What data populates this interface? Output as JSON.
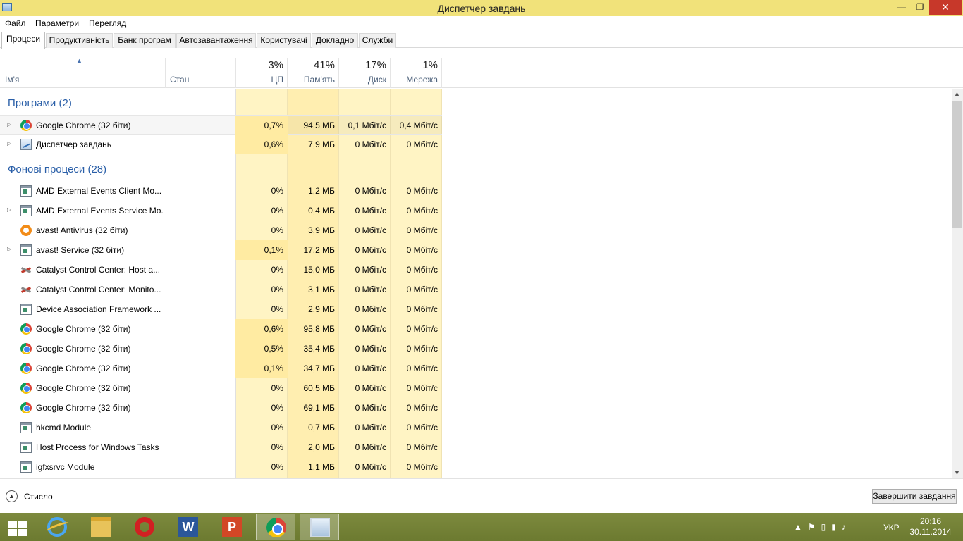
{
  "window": {
    "title": "Диспетчер завдань",
    "minimize": "—",
    "maximize": "❐",
    "close": "✕"
  },
  "menu": [
    "Файл",
    "Параметри",
    "Перегляд"
  ],
  "tabs": [
    "Процеси",
    "Продуктивність",
    "Банк програм",
    "Автозавантаження",
    "Користувачі",
    "Докладно",
    "Служби"
  ],
  "columns": {
    "name": "Ім'я",
    "status": "Стан",
    "cpu": {
      "label": "ЦП",
      "total": "3%"
    },
    "memory": {
      "label": "Пам'ять",
      "total": "41%"
    },
    "disk": {
      "label": "Диск",
      "total": "17%"
    },
    "network": {
      "label": "Мережа",
      "total": "1%"
    }
  },
  "groups": {
    "apps": "Програми (2)",
    "background": "Фонові процеси (28)"
  },
  "apps": [
    {
      "name": "Google Chrome (32 біти)",
      "icon": "chrome-icon",
      "expandable": true,
      "cpu": "0,7%",
      "memory": "94,5 МБ",
      "disk": "0,1 Мбіт/с",
      "network": "0,4 Мбіт/с"
    },
    {
      "name": "Диспетчер завдань",
      "icon": "task-manager-icon",
      "expandable": true,
      "cpu": "0,6%",
      "memory": "7,9 МБ",
      "disk": "0 Мбіт/с",
      "network": "0 Мбіт/с"
    }
  ],
  "background": [
    {
      "name": "AMD External Events Client Mo...",
      "icon": "app-window-icon",
      "expandable": false,
      "cpu": "0%",
      "memory": "1,2 МБ",
      "disk": "0 Мбіт/с",
      "network": "0 Мбіт/с"
    },
    {
      "name": "AMD External Events Service Mo...",
      "icon": "app-window-icon",
      "expandable": true,
      "cpu": "0%",
      "memory": "0,4 МБ",
      "disk": "0 Мбіт/с",
      "network": "0 Мбіт/с"
    },
    {
      "name": "avast! Antivirus (32 біти)",
      "icon": "avast-icon",
      "expandable": false,
      "cpu": "0%",
      "memory": "3,9 МБ",
      "disk": "0 Мбіт/с",
      "network": "0 Мбіт/с"
    },
    {
      "name": "avast! Service (32 біти)",
      "icon": "app-window-icon",
      "expandable": true,
      "cpu": "0,1%",
      "memory": "17,2 МБ",
      "disk": "0 Мбіт/с",
      "network": "0 Мбіт/с"
    },
    {
      "name": "Catalyst Control Center: Host a...",
      "icon": "amd-catalyst-icon",
      "expandable": false,
      "cpu": "0%",
      "memory": "15,0 МБ",
      "disk": "0 Мбіт/с",
      "network": "0 Мбіт/с"
    },
    {
      "name": "Catalyst Control Center: Monito...",
      "icon": "amd-catalyst-icon",
      "expandable": false,
      "cpu": "0%",
      "memory": "3,1 МБ",
      "disk": "0 Мбіт/с",
      "network": "0 Мбіт/с"
    },
    {
      "name": "Device Association Framework ...",
      "icon": "app-window-icon",
      "expandable": false,
      "cpu": "0%",
      "memory": "2,9 МБ",
      "disk": "0 Мбіт/с",
      "network": "0 Мбіт/с"
    },
    {
      "name": "Google Chrome (32 біти)",
      "icon": "chrome-icon",
      "expandable": false,
      "cpu": "0,6%",
      "memory": "95,8 МБ",
      "disk": "0 Мбіт/с",
      "network": "0 Мбіт/с"
    },
    {
      "name": "Google Chrome (32 біти)",
      "icon": "chrome-icon",
      "expandable": false,
      "cpu": "0,5%",
      "memory": "35,4 МБ",
      "disk": "0 Мбіт/с",
      "network": "0 Мбіт/с"
    },
    {
      "name": "Google Chrome (32 біти)",
      "icon": "chrome-icon",
      "expandable": false,
      "cpu": "0,1%",
      "memory": "34,7 МБ",
      "disk": "0 Мбіт/с",
      "network": "0 Мбіт/с"
    },
    {
      "name": "Google Chrome (32 біти)",
      "icon": "chrome-icon",
      "expandable": false,
      "cpu": "0%",
      "memory": "60,5 МБ",
      "disk": "0 Мбіт/с",
      "network": "0 Мбіт/с"
    },
    {
      "name": "Google Chrome (32 біти)",
      "icon": "chrome-icon",
      "expandable": false,
      "cpu": "0%",
      "memory": "69,1 МБ",
      "disk": "0 Мбіт/с",
      "network": "0 Мбіт/с"
    },
    {
      "name": "hkcmd Module",
      "icon": "app-window-icon",
      "expandable": false,
      "cpu": "0%",
      "memory": "0,7 МБ",
      "disk": "0 Мбіт/с",
      "network": "0 Мбіт/с"
    },
    {
      "name": "Host Process for Windows Tasks",
      "icon": "app-window-icon",
      "expandable": false,
      "cpu": "0%",
      "memory": "2,0 МБ",
      "disk": "0 Мбіт/с",
      "network": "0 Мбіт/с"
    },
    {
      "name": "igfxsrvc Module",
      "icon": "app-window-icon",
      "expandable": false,
      "cpu": "0%",
      "memory": "1,1 МБ",
      "disk": "0 Мбіт/с",
      "network": "0 Мбіт/с"
    }
  ],
  "footer": {
    "less_details": "Стисло",
    "end_task": "Завершити завдання"
  },
  "taskbar": {
    "items": [
      "start-icon",
      "internet-explorer-icon",
      "file-explorer-icon",
      "opera-icon",
      "word-icon",
      "powerpoint-icon",
      "chrome-icon",
      "task-manager-icon"
    ],
    "language": "УКР",
    "time": "20:16",
    "date": "30.11.2014"
  },
  "colors": {
    "titlebar": "#f1e27a",
    "heat_light": "#fff4c4",
    "heat_medium": "#ffeba2",
    "group_text": "#2a5fa8",
    "close_button": "#c7382a"
  }
}
